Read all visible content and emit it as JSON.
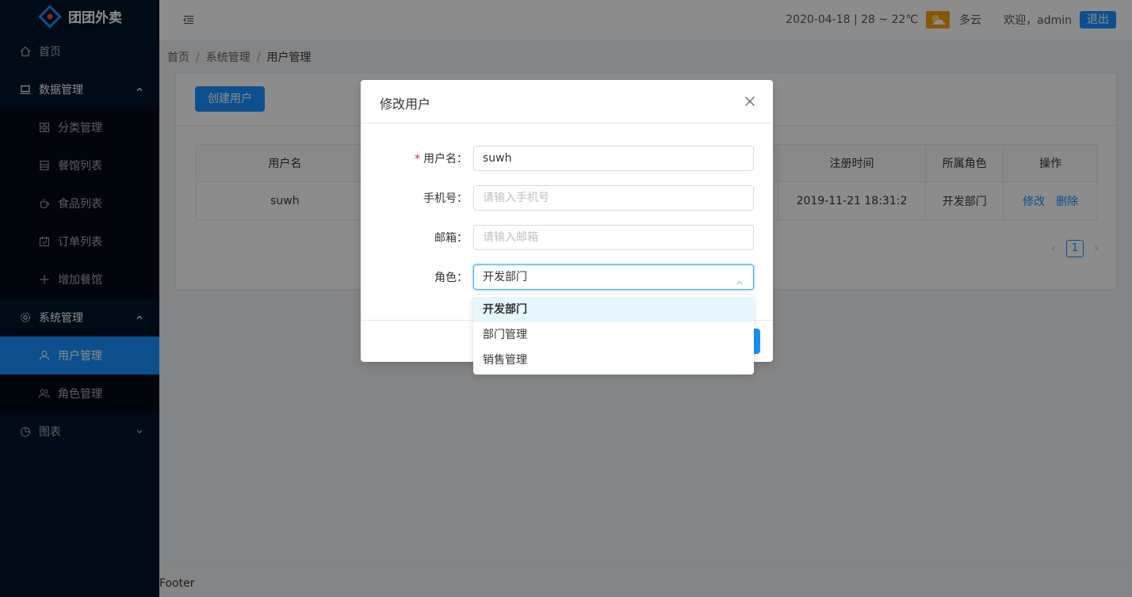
{
  "app": {
    "name": "团团外卖"
  },
  "sidebar": {
    "items": [
      {
        "label": "首页",
        "icon": "home-icon"
      },
      {
        "label": "数据管理",
        "icon": "laptop-icon",
        "children": [
          {
            "label": "分类管理",
            "icon": "appstore-icon"
          },
          {
            "label": "餐馆列表",
            "icon": "database-icon"
          },
          {
            "label": "食品列表",
            "icon": "coffee-icon"
          },
          {
            "label": "订单列表",
            "icon": "calendar-icon"
          },
          {
            "label": "增加餐馆",
            "icon": "plus-icon"
          }
        ]
      },
      {
        "label": "系统管理",
        "icon": "setting-icon",
        "children": [
          {
            "label": "用户管理",
            "icon": "user-icon",
            "active": true
          },
          {
            "label": "角色管理",
            "icon": "team-icon"
          }
        ]
      },
      {
        "label": "图表",
        "icon": "pie-chart-icon"
      }
    ]
  },
  "header": {
    "date_weather": "2020-04-18 | 28 ~ 22℃",
    "weather": "多云",
    "welcome": "欢迎，admin",
    "logout": "退出"
  },
  "breadcrumb": [
    "首页",
    "系统管理",
    "用户管理"
  ],
  "toolbar": {
    "create_label": "创建用户"
  },
  "table": {
    "columns": [
      "用户名",
      "",
      "注册时间",
      "所属角色",
      "操作"
    ],
    "rows": [
      {
        "username": "suwh",
        "register_time": "2019-11-21 18:31:2",
        "role": "开发部门",
        "edit": "修改",
        "delete": "删除"
      }
    ]
  },
  "pagination": {
    "current": "1",
    "prev": "‹",
    "next": "›"
  },
  "footer": {
    "text": "Footer"
  },
  "modal": {
    "title": "修改用户",
    "fields": {
      "username": {
        "label": "用户名",
        "value": "suwh"
      },
      "phone": {
        "label": "手机号",
        "placeholder": "请输入手机号"
      },
      "email": {
        "label": "邮箱",
        "placeholder": "请输入邮箱"
      },
      "role": {
        "label": "角色",
        "value": "开发部门"
      }
    },
    "role_options": [
      "开发部门",
      "部门管理",
      "销售管理"
    ]
  },
  "colors": {
    "primary": "#1890ff",
    "sidebar_bg": "#001529",
    "submenu_bg": "#000c17"
  }
}
